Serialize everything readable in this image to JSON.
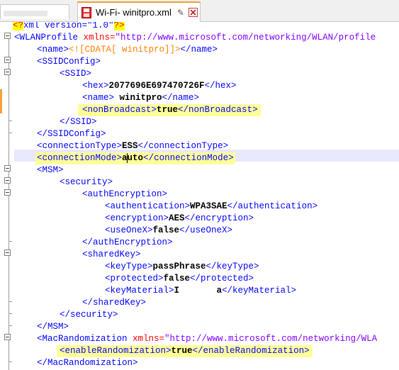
{
  "tab": {
    "title": "Wi-Fi- winitpro.xml",
    "pin_icon": "pin-icon",
    "close_icon": "close-icon"
  },
  "lines": {
    "l1": {
      "pi_open": "<?",
      "rest": "xml version=\"1.0\"",
      "pi_close": "?>"
    },
    "l2": {
      "open": "<WLANProfile",
      "attr": " xmlns=",
      "val": "\"http://www.microsoft.com/networking/WLAN/profile"
    },
    "l3": {
      "open": "<name>",
      "cdata": "<![CDATA[ winitpro]]>",
      "close": "</name>"
    },
    "l4": {
      "open": "<SSIDConfig>"
    },
    "l5": {
      "open": "<SSID>"
    },
    "l6": {
      "open": "<hex>",
      "text": "2077696E697470726F",
      "close": "</hex>"
    },
    "l7": {
      "open": "<name>",
      "text": " winitpro",
      "close": "</name>"
    },
    "l8": {
      "open": "<nonBroadcast>",
      "text": "true",
      "close": "</nonBroadcast>"
    },
    "l9": {
      "close": "</SSID>"
    },
    "l10": {
      "close": "</SSIDConfig>"
    },
    "l11": {
      "open": "<connectionType>",
      "text": "ESS",
      "close": "</connectionType>"
    },
    "l12": {
      "open": "<connectionMode>",
      "text_a": "a",
      "text_b": "uto",
      "close": "</connectionMode>"
    },
    "l13": {
      "open": "<MSM>"
    },
    "l14": {
      "open": "<security>"
    },
    "l15": {
      "open": "<authEncryption>"
    },
    "l16": {
      "open": "<authentication>",
      "text": "WPA3SAE",
      "close": "</authentication>"
    },
    "l17": {
      "open": "<encryption>",
      "text": "AES",
      "close": "</encryption>"
    },
    "l18": {
      "open": "<useOneX>",
      "text": "false",
      "close": "</useOneX>"
    },
    "l19": {
      "close": "</authEncryption>"
    },
    "l20": {
      "open": "<sharedKey>"
    },
    "l21": {
      "open": "<keyType>",
      "text": "passPhrase",
      "close": "</keyType>"
    },
    "l22": {
      "open": "<protected>",
      "text": "false",
      "close": "</protected>"
    },
    "l23": {
      "open": "<keyMaterial>",
      "text": "I       a",
      "close": "</keyMaterial>"
    },
    "l24": {
      "close": "</sharedKey>"
    },
    "l25": {
      "close": "</security>"
    },
    "l26": {
      "close": "</MSM>"
    },
    "l27": {
      "open": "<MacRandomization",
      "attr": " xmlns=",
      "val": "\"http://www.microsoft.com/networking/WLA"
    },
    "l28": {
      "open": "<enableRandomization>",
      "text": "true",
      "close": "</enableRandomization>"
    },
    "l29": {
      "close": "</MacRandomization>"
    }
  },
  "colors": {
    "tag": "#0000ff",
    "attribute": "#ff0000",
    "attr_value": "#8000ff",
    "cdata": "#ff8000",
    "highlight": "#ffff99",
    "caret_line": "#e8e8ff"
  }
}
